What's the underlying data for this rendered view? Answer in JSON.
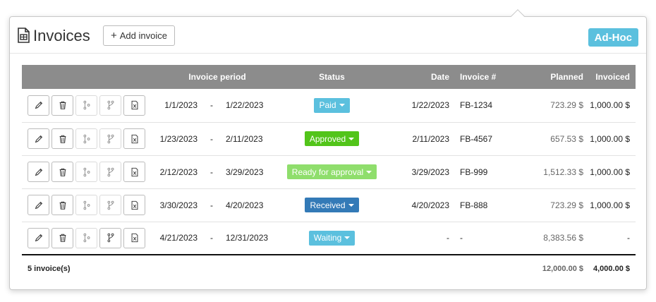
{
  "header": {
    "title": "Invoices",
    "title_icon": "document-icon",
    "add_button_label": "Add invoice",
    "tag": "Ad-Hoc",
    "tag_color": "#5bc0de"
  },
  "table": {
    "columns": {
      "period": "Invoice period",
      "status": "Status",
      "date": "Date",
      "invoice_no": "Invoice #",
      "planned": "Planned",
      "invoiced": "Invoiced"
    },
    "action_icons": [
      "pencil-icon",
      "trash-icon",
      "branch-icon",
      "merge-icon",
      "excel-icon"
    ],
    "rows": [
      {
        "from": "1/1/2023",
        "dash": "-",
        "to": "1/22/2023",
        "status": "Paid",
        "status_color": "#5bc0de",
        "date": "1/22/2023",
        "invoice_no": "FB-1234",
        "planned": "723.29 $",
        "invoiced": "1,000.00 $"
      },
      {
        "from": "1/23/2023",
        "dash": "-",
        "to": "2/11/2023",
        "status": "Approved",
        "status_color": "#52c41a",
        "date": "2/11/2023",
        "invoice_no": "FB-4567",
        "planned": "657.53 $",
        "invoiced": "1,000.00 $"
      },
      {
        "from": "2/12/2023",
        "dash": "-",
        "to": "3/29/2023",
        "status": "Ready for approval",
        "status_color": "#8fde6c",
        "date": "3/29/2023",
        "invoice_no": "FB-999",
        "planned": "1,512.33 $",
        "invoiced": "1,000.00 $"
      },
      {
        "from": "3/30/2023",
        "dash": "-",
        "to": "4/20/2023",
        "status": "Received",
        "status_color": "#337ab7",
        "date": "4/20/2023",
        "invoice_no": "FB-888",
        "planned": "723.29 $",
        "invoiced": "1,000.00 $"
      },
      {
        "from": "4/21/2023",
        "dash": "-",
        "to": "12/31/2023",
        "status": "Waiting",
        "status_color": "#5bc0de",
        "date": "-",
        "invoice_no": "-",
        "planned": "8,383.56 $",
        "invoiced": "-"
      }
    ],
    "footer": {
      "count": "5 invoice(s)",
      "planned_total": "12,000.00 $",
      "invoiced_total": "4,000.00 $"
    }
  }
}
